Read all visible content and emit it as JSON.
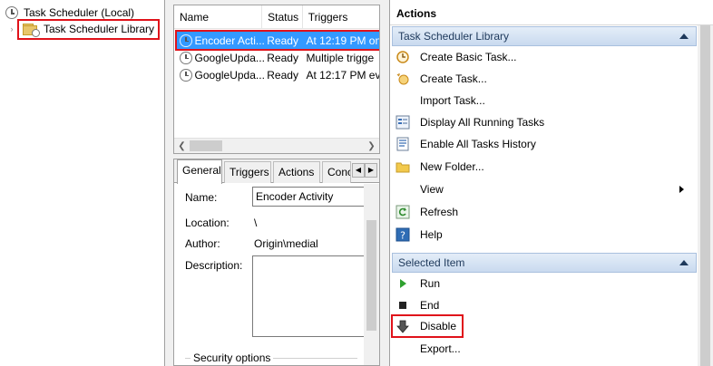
{
  "tree": {
    "root_label": "Task Scheduler (Local)",
    "library_label": "Task Scheduler Library"
  },
  "task_list": {
    "columns": [
      "Name",
      "Status",
      "Triggers"
    ],
    "rows": [
      {
        "name": "Encoder Acti...",
        "status": "Ready",
        "triggers": "At 12:19 PM on",
        "selected": true
      },
      {
        "name": "GoogleUpda...",
        "status": "Ready",
        "triggers": "Multiple trigge",
        "selected": false
      },
      {
        "name": "GoogleUpda...",
        "status": "Ready",
        "triggers": "At 12:17 PM ev",
        "selected": false
      }
    ]
  },
  "details": {
    "tabs": [
      "General",
      "Triggers",
      "Actions",
      "Conc"
    ],
    "active_tab": "General",
    "name_label": "Name:",
    "name_value": "Encoder Activity",
    "location_label": "Location:",
    "location_value": "\\",
    "author_label": "Author:",
    "author_value": "Origin\\medial",
    "description_label": "Description:",
    "security_options_label": "Security options"
  },
  "actions": {
    "title": "Actions",
    "library_section": "Task Scheduler Library",
    "library_items": [
      {
        "label": "Create Basic Task...",
        "icon": "basic-task-icon"
      },
      {
        "label": "Create Task...",
        "icon": "create-task-icon"
      },
      {
        "label": "Import Task...",
        "icon": "none"
      },
      {
        "label": "Display All Running Tasks",
        "icon": "running-tasks-icon"
      },
      {
        "label": "Enable All Tasks History",
        "icon": "history-icon"
      },
      {
        "label": "New Folder...",
        "icon": "folder-icon"
      },
      {
        "label": "View",
        "icon": "none"
      },
      {
        "label": "Refresh",
        "icon": "refresh-icon"
      },
      {
        "label": "Help",
        "icon": "help-icon"
      }
    ],
    "selected_section": "Selected Item",
    "selected_items": [
      {
        "label": "Run",
        "icon": "run-icon"
      },
      {
        "label": "End",
        "icon": "end-icon"
      },
      {
        "label": "Disable",
        "icon": "disable-icon"
      },
      {
        "label": "Export...",
        "icon": "none"
      }
    ]
  },
  "colors": {
    "selection": "#3399ff",
    "highlight_border": "#e0121a",
    "section_header": "#c9daef"
  }
}
